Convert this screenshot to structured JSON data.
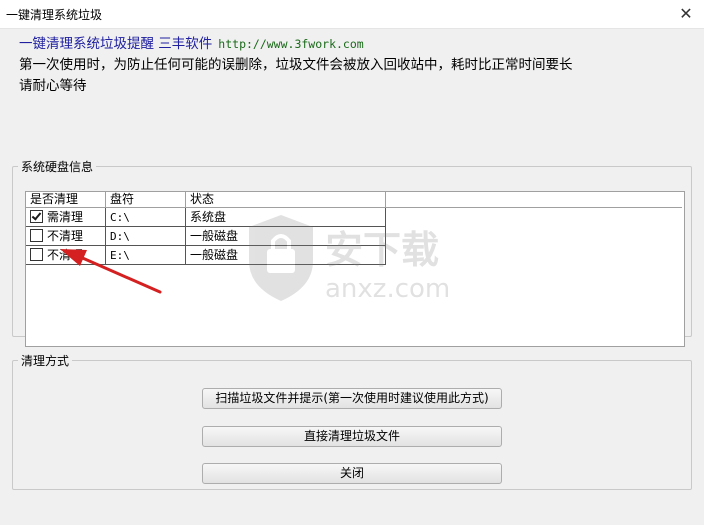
{
  "window": {
    "title": "一键清理系统垃圾",
    "close_glyph": "✕"
  },
  "notice": {
    "heading": "一键清理系统垃圾提醒 三丰软件",
    "url": "http://www.3fwork.com",
    "line2": "第一次使用时，为防止任何可能的误删除，垃圾文件会被放入回收站中，耗时比正常时间要长",
    "line3": "请耐心等待"
  },
  "disk_group": {
    "legend": "系统硬盘信息",
    "columns": [
      "是否清理",
      "盘符",
      "状态"
    ],
    "rows": [
      {
        "checked": true,
        "clean": "需清理",
        "drive": "C:\\",
        "status": "系统盘"
      },
      {
        "checked": false,
        "clean": "不清理",
        "drive": "D:\\",
        "status": "一般磁盘"
      },
      {
        "checked": false,
        "clean": "不清理",
        "drive": "E:\\",
        "status": "一般磁盘"
      }
    ]
  },
  "clean_group": {
    "legend": "清理方式",
    "scan_button": "扫描垃圾文件并提示(第一次使用时建议使用此方式)",
    "direct_button": "直接清理垃圾文件",
    "close_button": "关闭"
  },
  "watermark": {
    "brand": "安下载",
    "domain": "anxz.com"
  },
  "colors": {
    "annotation_arrow": "#d42020",
    "heading_text": "#2020a0",
    "url_text": "#1a6a1a"
  }
}
